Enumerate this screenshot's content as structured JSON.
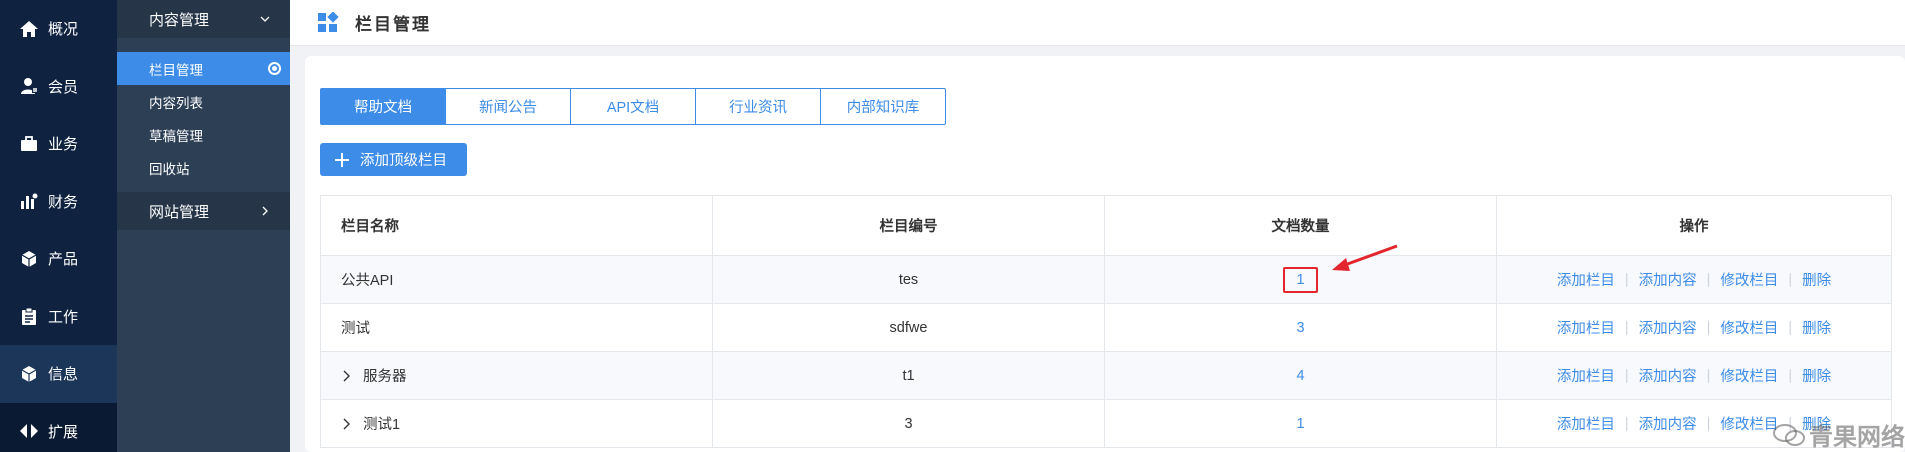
{
  "primary_nav": [
    {
      "icon": "home-icon",
      "label": "概况"
    },
    {
      "icon": "member-icon",
      "label": "会员"
    },
    {
      "icon": "briefcase-icon",
      "label": "业务"
    },
    {
      "icon": "finance-icon",
      "label": "财务"
    },
    {
      "icon": "product-icon",
      "label": "产品"
    },
    {
      "icon": "clipboard-icon",
      "label": "工作"
    },
    {
      "icon": "info-icon",
      "label": "信息"
    },
    {
      "icon": "extend-icon",
      "label": "扩展"
    }
  ],
  "secondary_nav": {
    "group1": "内容管理",
    "items": [
      "栏目管理",
      "内容列表",
      "草稿管理",
      "回收站"
    ],
    "group2": "网站管理"
  },
  "header": {
    "title": "栏目管理"
  },
  "tabs": [
    "帮助文档",
    "新闻公告",
    "API文档",
    "行业资讯",
    "内部知识库"
  ],
  "add_button": "添加顶级栏目",
  "table": {
    "columns": [
      "栏目名称",
      "栏目编号",
      "文档数量",
      "操作"
    ],
    "rows": [
      {
        "name": "公共API",
        "code": "tes",
        "count": "1"
      },
      {
        "name": "测试",
        "code": "sdfwe",
        "count": "3"
      },
      {
        "name": "服务器",
        "code": "t1",
        "count": "4"
      },
      {
        "name": "测试1",
        "code": "3",
        "count": "1"
      }
    ],
    "actions": [
      "添加栏目",
      "添加内容",
      "修改栏目",
      "删除"
    ]
  },
  "watermark": "青果网络",
  "colors": {
    "accent": "#3d8ce8",
    "sidebar": "#0f2240",
    "highlight": "#e3262d"
  }
}
